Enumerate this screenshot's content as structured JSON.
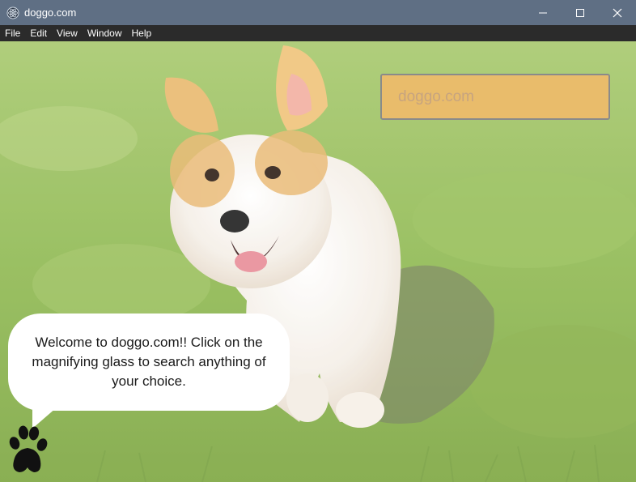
{
  "window": {
    "title": "doggo.com"
  },
  "menu": {
    "items": [
      "File",
      "Edit",
      "View",
      "Window",
      "Help"
    ]
  },
  "search": {
    "placeholder": "doggo.com"
  },
  "bubble": {
    "text": "Welcome to doggo.com!! Click on the magnifying glass to search anything of your choice."
  },
  "icons": {
    "app": "electron-icon",
    "minimize": "minimize-icon",
    "maximize": "maximize-icon",
    "close": "close-icon",
    "paw": "paw-icon"
  },
  "colors": {
    "titlebar": "#5f6f84",
    "menubar": "#2b2b2b",
    "search_bg": "#e9bc6b",
    "bubble_bg": "#ffffff"
  }
}
